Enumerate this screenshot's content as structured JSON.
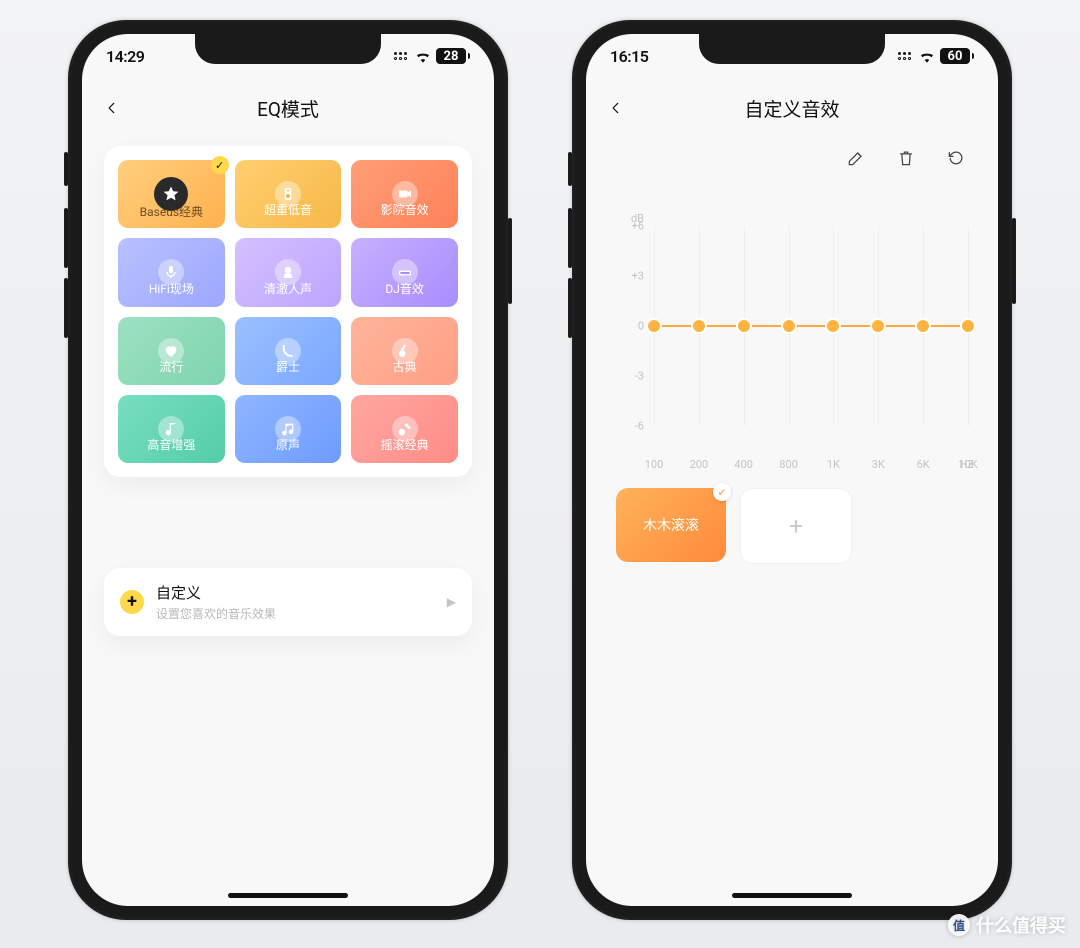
{
  "watermark": "什么值得买",
  "screen_left": {
    "status": {
      "time": "14:29",
      "battery": "28"
    },
    "header": {
      "title": "EQ模式"
    },
    "tiles": [
      {
        "label": "Baseus经典",
        "color_from": "#ffcf7d",
        "color_to": "#ffb14f",
        "selected": true,
        "icon": "star",
        "text_color": "#6b4e26"
      },
      {
        "label": "超重低音",
        "color_from": "#ffcf6e",
        "color_to": "#f7b84a",
        "icon": "speaker"
      },
      {
        "label": "影院音效",
        "color_from": "#ff9e76",
        "color_to": "#ff8159",
        "icon": "camera"
      },
      {
        "label": "HiFi现场",
        "color_from": "#b9c1ff",
        "color_to": "#9ca7ff",
        "icon": "mic"
      },
      {
        "label": "清澈人声",
        "color_from": "#d3c1ff",
        "color_to": "#bda5ff",
        "icon": "head"
      },
      {
        "label": "DJ音效",
        "color_from": "#c7b0ff",
        "color_to": "#a98cff",
        "icon": "dj"
      },
      {
        "label": "流行",
        "color_from": "#9de0c3",
        "color_to": "#7ed5ae",
        "icon": "heart"
      },
      {
        "label": "爵士",
        "color_from": "#9cc0ff",
        "color_to": "#7aa8ff",
        "icon": "sax"
      },
      {
        "label": "古典",
        "color_from": "#ffb49a",
        "color_to": "#ff9f86",
        "icon": "banjo"
      },
      {
        "label": "高音增强",
        "color_from": "#78dec0",
        "color_to": "#54cda6",
        "icon": "note"
      },
      {
        "label": "原声",
        "color_from": "#8fb5ff",
        "color_to": "#6e9cff",
        "icon": "note2"
      },
      {
        "label": "摇滚经典",
        "color_from": "#ffa7a0",
        "color_to": "#ff8c86",
        "icon": "guitar"
      }
    ],
    "custom": {
      "title": "自定义",
      "subtitle": "设置您喜欢的音乐效果"
    }
  },
  "screen_right": {
    "status": {
      "time": "16:15",
      "battery": "60"
    },
    "header": {
      "title": "自定义音效"
    },
    "chart_data": {
      "type": "line",
      "title": "",
      "ylabel": "dB",
      "ylim": [
        -6,
        6
      ],
      "y_ticks": [
        6,
        3,
        0,
        -3,
        -6
      ],
      "x_labels": [
        "100",
        "200",
        "400",
        "800",
        "1K",
        "3K",
        "6K",
        "10K"
      ],
      "values": [
        0,
        0,
        0,
        0,
        0,
        0,
        0,
        0
      ],
      "hz_label": "HZ"
    },
    "preset": {
      "active_label": "木木滚滚"
    }
  }
}
